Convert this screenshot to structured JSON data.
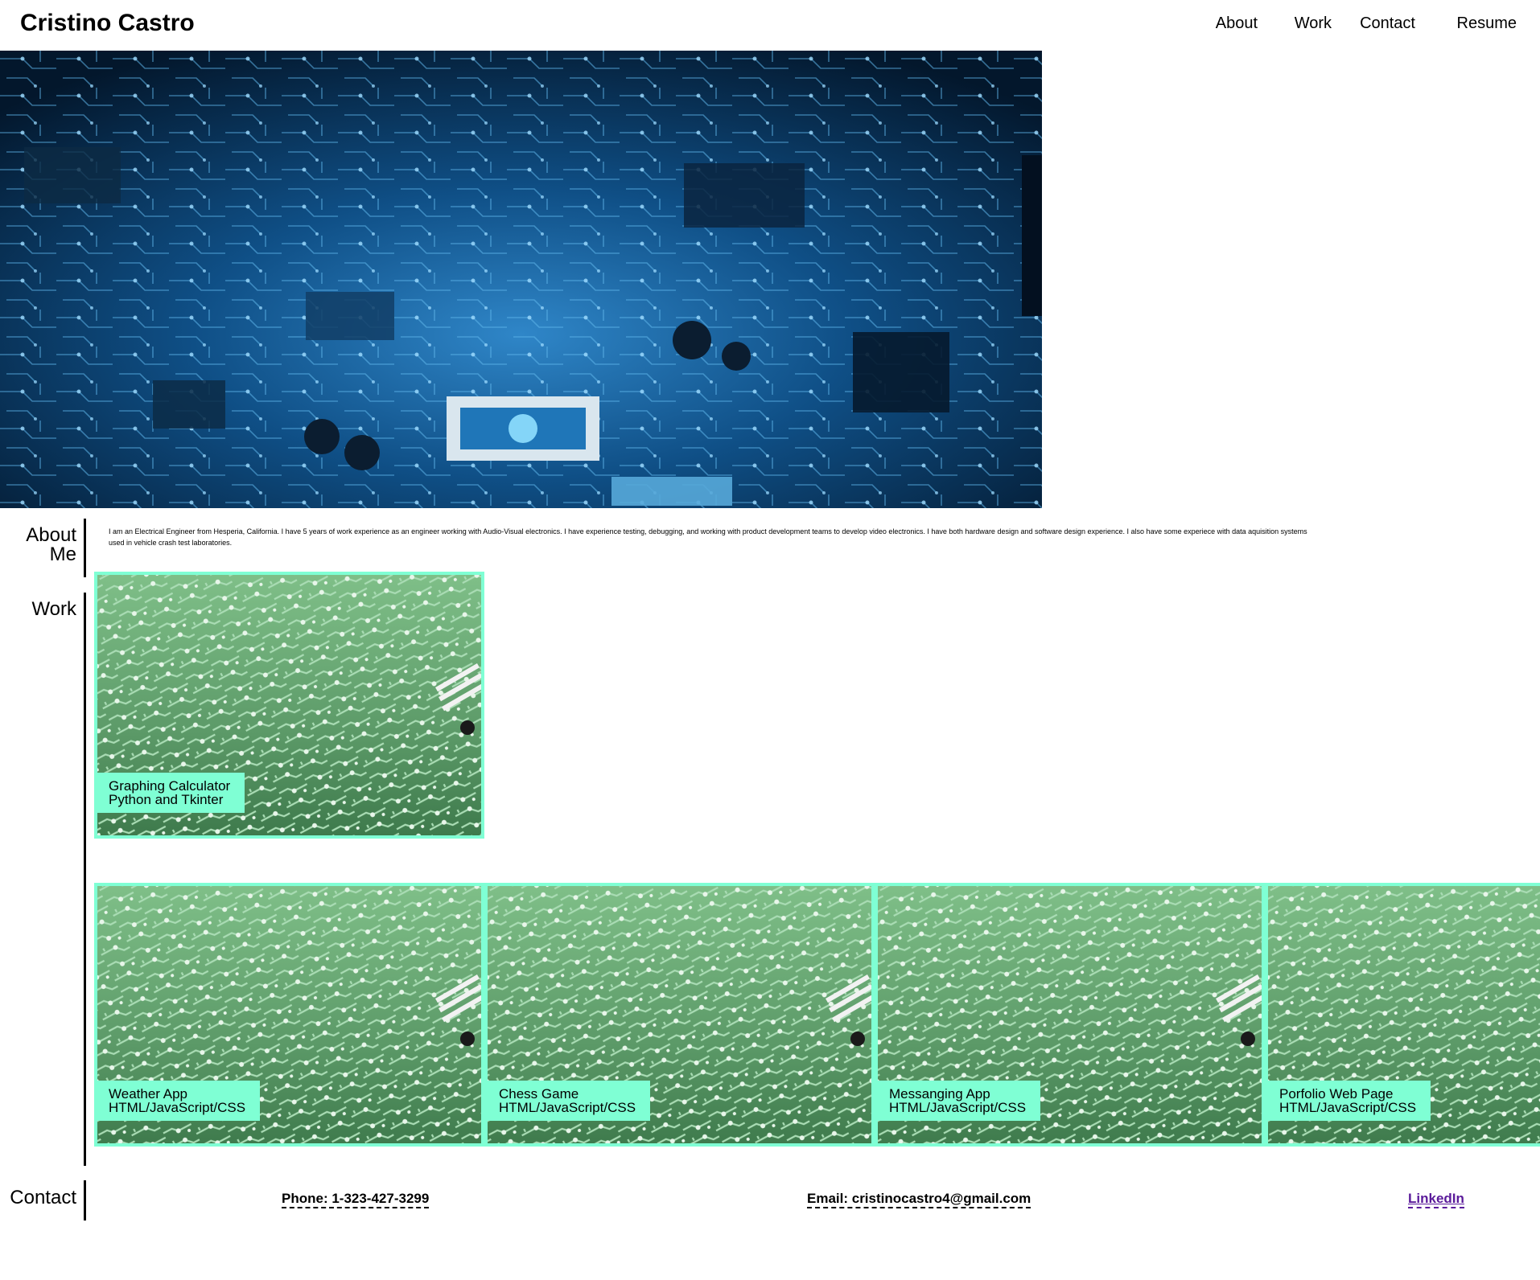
{
  "header": {
    "brand": "Cristino Castro",
    "nav": [
      {
        "label": "About"
      },
      {
        "label": "Work"
      },
      {
        "label": "Contact"
      },
      {
        "label": "Resume"
      }
    ]
  },
  "hero": {
    "alt": "blue circuit board"
  },
  "about": {
    "heading_line1": "About",
    "heading_line2": "Me",
    "text": "I am an Electrical Engineer from Hesperia, California. I have 5 years of work experience as an engineer working with Audio-Visual electronics. I have experience testing, debugging, and working with product development teams to develop video electronics. I have both hardware design and software design experience. I also have some experiece with data aquisition systems used in vehicle crash test laboratories."
  },
  "work": {
    "heading": "Work",
    "projects": [
      {
        "title": "Graphing Calculator",
        "tech": "Python and Tkinter"
      },
      {
        "title": "Weather App",
        "tech": "HTML/JavaScript/CSS"
      },
      {
        "title": "Chess Game",
        "tech": "HTML/JavaScript/CSS"
      },
      {
        "title": "Messanging App",
        "tech": "HTML/JavaScript/CSS"
      },
      {
        "title": "Porfolio Web Page",
        "tech": "HTML/JavaScript/CSS"
      }
    ]
  },
  "contact": {
    "heading": "Contact",
    "phone": "Phone: 1-323-427-3299",
    "email": "Email: cristinocastro4@gmail.com",
    "linkedin": "LinkedIn"
  },
  "colors": {
    "accent": "#7fffd4",
    "board_green": "#5c9a68",
    "hero_blue": "#0a3a66"
  }
}
